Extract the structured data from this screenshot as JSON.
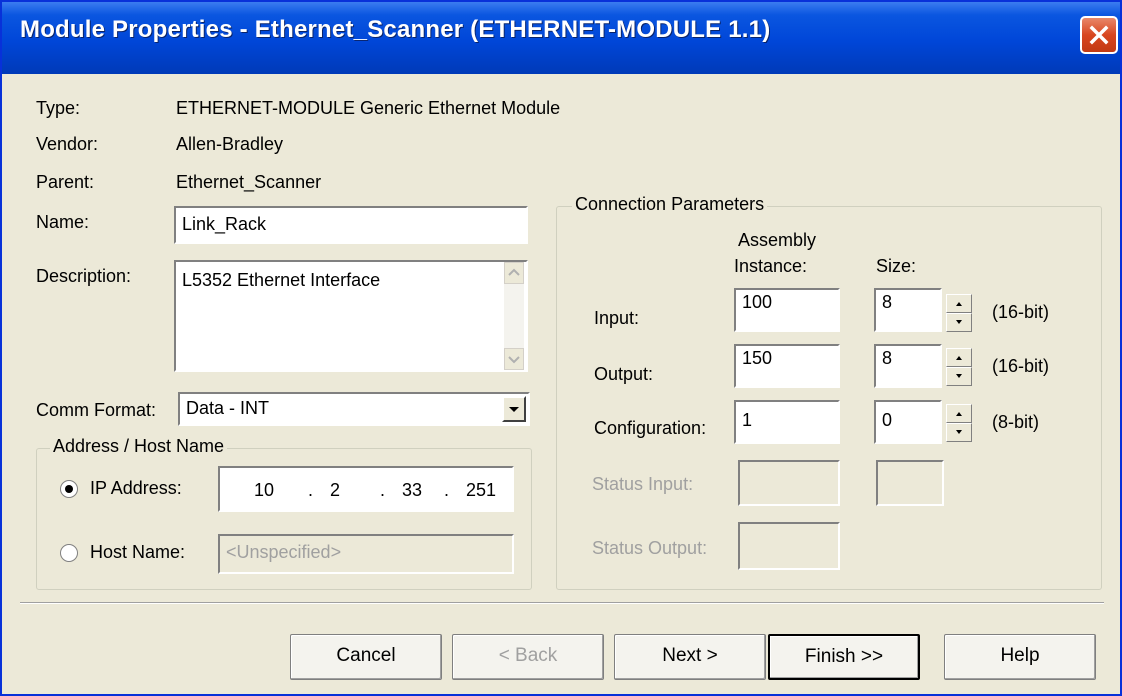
{
  "window": {
    "title": "Module Properties - Ethernet_Scanner (ETHERNET-MODULE 1.1)"
  },
  "info": {
    "type_label": "Type:",
    "type_value": "ETHERNET-MODULE Generic Ethernet Module",
    "vendor_label": "Vendor:",
    "vendor_value": "Allen-Bradley",
    "parent_label": "Parent:",
    "parent_value": "Ethernet_Scanner",
    "name_label": "Name:",
    "name_value": "Link_Rack",
    "description_label": "Description:",
    "description_value": "L5352 Ethernet Interface",
    "comm_format_label": "Comm Format:",
    "comm_format_value": "Data - INT"
  },
  "address": {
    "group_title": "Address / Host Name",
    "ip_label": "IP Address:",
    "ip": [
      "10",
      "2",
      "33",
      "251"
    ],
    "host_label": "Host Name:",
    "host_placeholder": "<Unspecified>"
  },
  "connection": {
    "group_title": "Connection Parameters",
    "col_assembly_line1": "Assembly",
    "col_assembly_line2": "Instance:",
    "col_size": "Size:",
    "rows": [
      {
        "label": "Input:",
        "instance": "100",
        "size": "8",
        "unit": "(16-bit)"
      },
      {
        "label": "Output:",
        "instance": "150",
        "size": "8",
        "unit": "(16-bit)"
      },
      {
        "label": "Configuration:",
        "instance": "1",
        "size": "0",
        "unit": "(8-bit)"
      }
    ],
    "status_input_label": "Status Input:",
    "status_output_label": "Status Output:"
  },
  "buttons": {
    "cancel": "Cancel",
    "back": "< Back",
    "next": "Next >",
    "finish": "Finish >>",
    "help": "Help"
  }
}
